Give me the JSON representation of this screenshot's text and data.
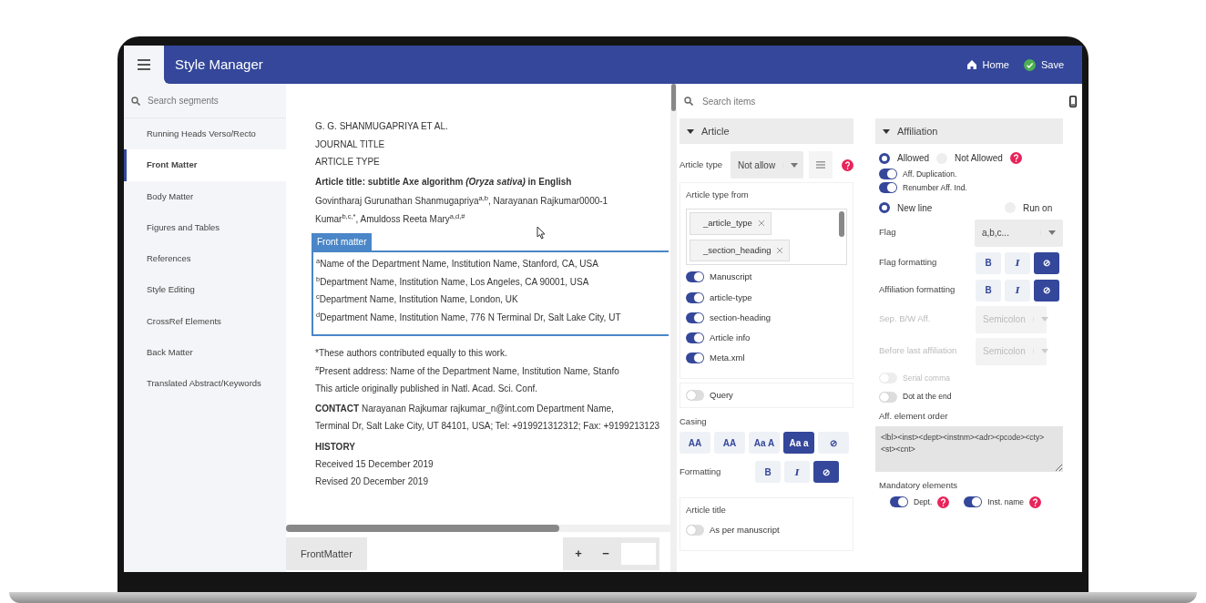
{
  "app_bar": {
    "title": "Style Manager",
    "actions": [
      {
        "label": "Home",
        "kind": "home"
      },
      {
        "label": "Save",
        "kind": "save"
      }
    ]
  },
  "sidebar": {
    "search": {
      "placeholder": "Search segments"
    },
    "items": [
      {
        "label": "Running Heads Verso/Recto",
        "selected": false
      },
      {
        "label": "Front Matter",
        "selected": true
      },
      {
        "label": "Body Matter",
        "selected": false
      },
      {
        "label": "Figures and Tables",
        "selected": false
      },
      {
        "label": "References",
        "selected": false
      },
      {
        "label": "Style Editing",
        "selected": false
      },
      {
        "label": "CrossRef Elements",
        "selected": false
      },
      {
        "label": "Back Matter",
        "selected": false
      },
      {
        "label": "Translated Abstract/Keywords",
        "selected": false
      }
    ]
  },
  "document": {
    "blocks": [
      {
        "kind": "text",
        "lines": [
          "G. G. SHANMUGAPRIYA ET AL.",
          "JOURNAL TITLE",
          "ARTICLE TYPE"
        ]
      },
      {
        "kind": "title",
        "lines": [
          "Article title: subtitle Axe algorithm *(Oryza sativa)* in English"
        ]
      },
      {
        "kind": "text",
        "lines": [
          "Govintharaj Gurunathan Shanmugapriya$^{a,b}$, Narayanan Rajkumar0000-1",
          "Kumar$^{b,c,*}$, Amuldoss Reeta Mary$^{a,d,#}$"
        ]
      },
      {
        "kind": "frame",
        "label": "Front matter",
        "lines": [
          "$^{a}$Name of the Department Name, Institution Name, Stanford, CA, USA",
          "$^{b}$Department Name, Institution Name, Los Angeles, CA 90001, USA",
          "$^{c}$Department Name, Institution Name, London, UK",
          "$^{d}$Department Name, Institution Name, 776 N Terminal Dr, Salt Lake City, UT"
        ]
      },
      {
        "kind": "text",
        "lines": [
          "*These authors contributed equally to this work.",
          "$^{#}$Present address: Name of the Department Name, Institution Name, Stanfo",
          "This article originally published in Natl. Acad. Sci. Conf."
        ]
      },
      {
        "kind": "text",
        "lines": [
          "**CONTACT** Narayanan Rajkumar rajkumar_n@int.com Department Name,",
          "Terminal Dr, Salt Lake City, UT 84101, USA; Tel: +919921312312; Fax: +9199213123"
        ]
      },
      {
        "kind": "section",
        "heading": "HISTORY",
        "lines": [
          "Received 15 December 2019",
          "Revised 20 December 2019"
        ]
      }
    ]
  },
  "footer": {
    "tab": "FrontMatter",
    "zoom_in": "+",
    "zoom_out": "−"
  },
  "settings": {
    "search": {
      "placeholder": "Search items"
    },
    "article": {
      "title": "Article",
      "expanded": true,
      "article_type": {
        "label": "Article type",
        "value": "Not allow"
      },
      "type_from": {
        "label": "Article type from",
        "chips": [
          "_article_type",
          "_section_heading"
        ]
      },
      "switches": [
        {
          "label": "Manuscript",
          "on": true
        },
        {
          "label": "article-type",
          "on": true
        },
        {
          "label": "section-heading",
          "on": true
        },
        {
          "label": "Article info",
          "on": true
        },
        {
          "label": "Meta.xml",
          "on": true
        }
      ],
      "query": {
        "label": "Query",
        "on": false
      },
      "casing": {
        "label": "Casing",
        "options": [
          {
            "label": "AA",
            "selected": false
          },
          {
            "label": "AA",
            "selected": false
          },
          {
            "label": "Aa A",
            "selected": false
          },
          {
            "label": "Aa a",
            "selected": true
          },
          {
            "label": "⊘",
            "selected": false
          }
        ]
      },
      "formatting": {
        "label": "Formatting",
        "options": [
          {
            "label": "B",
            "selected": false
          },
          {
            "label": "I",
            "selected": false
          },
          {
            "label": "⊘",
            "selected": true
          }
        ]
      },
      "article_title": {
        "label": "Article title",
        "switch": {
          "label": "As per manuscript",
          "on": false
        }
      }
    },
    "affiliation": {
      "title": "Affiliation",
      "expanded": true,
      "mode": [
        {
          "label": "Allowed",
          "selected": true
        },
        {
          "label": "Not Allowed",
          "selected": false
        }
      ],
      "switches": [
        {
          "label": "Aff. Duplication.",
          "on": true
        },
        {
          "label": "Renumber Aff. Ind.",
          "on": true
        }
      ],
      "placement": [
        {
          "label": "New line",
          "selected": true
        },
        {
          "label": "Run on",
          "selected": false
        }
      ],
      "rows": [
        {
          "kind": "select",
          "label": "Flag",
          "value": "a,b,c...",
          "disabled": false
        },
        {
          "kind": "format",
          "label": "Flag formatting",
          "options": [
            {
              "label": "B",
              "selected": false
            },
            {
              "label": "I",
              "selected": false
            },
            {
              "label": "⊘",
              "selected": true
            }
          ]
        },
        {
          "kind": "format",
          "label": "Affiliation formatting",
          "options": [
            {
              "label": "B",
              "selected": false
            },
            {
              "label": "I",
              "selected": false
            },
            {
              "label": "⊘",
              "selected": true
            }
          ]
        },
        {
          "kind": "select",
          "label": "Sep. B/W Aff.",
          "value": "Semicolon",
          "disabled": true
        },
        {
          "kind": "select",
          "label": "Before last affiliation",
          "value": "Semicolon",
          "disabled": true
        },
        {
          "kind": "switch",
          "label": "Serial comma",
          "on": false,
          "disabled": true
        },
        {
          "kind": "switch",
          "label": "Dot at the end",
          "on": false,
          "disabled": false
        }
      ],
      "element_order": {
        "label": "Aff. element order",
        "value": "<lbl><inst><dept><instnm><adr><pcode><cty><st><cnt>"
      },
      "mandatory": {
        "label": "Mandatory elements",
        "items": [
          {
            "label": "Dept.",
            "on": true
          },
          {
            "label": "Inst. name",
            "on": true
          }
        ]
      }
    }
  }
}
